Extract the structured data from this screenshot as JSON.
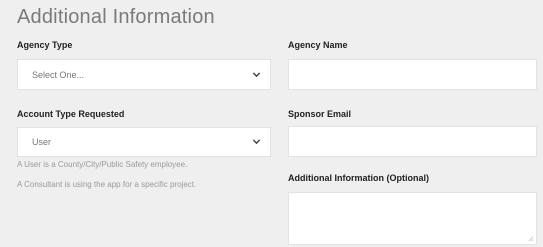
{
  "section": {
    "title": "Additional Information"
  },
  "left": {
    "agency_type": {
      "label": "Agency Type",
      "value": "Select One..."
    },
    "account_type": {
      "label": "Account Type Requested",
      "value": "User"
    },
    "help": [
      "A User is a County/City/Public Safety employee.",
      "A Consultant is using the app for a specific project."
    ]
  },
  "right": {
    "agency_name": {
      "label": "Agency Name",
      "value": ""
    },
    "sponsor_email": {
      "label": "Sponsor Email",
      "value": ""
    },
    "additional_info": {
      "label": "Additional Information (Optional)",
      "value": ""
    }
  },
  "icons": {
    "dropdown": "chevron-down-icon",
    "resize": "resize-grip-icon"
  },
  "colors": {
    "background": "#efefef",
    "field": "#ffffff",
    "title": "#7a7a7a"
  }
}
